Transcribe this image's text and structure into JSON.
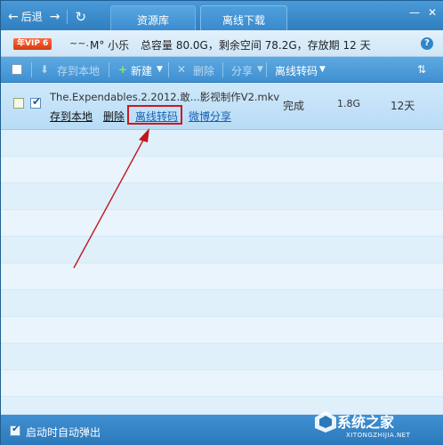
{
  "nav": {
    "back_label": "后退",
    "forward_icon": "forward-arrow-icon",
    "refresh_icon": "refresh-icon"
  },
  "tabs": [
    {
      "label": "资源库"
    },
    {
      "label": "离线下载"
    }
  ],
  "window": {
    "minimize_icon": "minimize-icon",
    "close_icon": "close-icon"
  },
  "account": {
    "vip_badge": "年VIP 6",
    "wave": "~~.",
    "username": "M° 小乐",
    "quota_text": "总容量 80.0G，剩余空间 78.2G，存放期 12 天",
    "help": "?"
  },
  "toolbar": {
    "save_local": "存到本地",
    "new": "新建",
    "delete": "删除",
    "share": "分享",
    "transcode": "离线转码",
    "sort_icon": "sort-icon"
  },
  "tasks": [
    {
      "name": "The.Expendables.2.2012.敢...影视制作V2.mkv",
      "actions": [
        "存到本地",
        "删除",
        "离线转码",
        "微博分享"
      ],
      "status": "完成",
      "size": "1.8G",
      "days": "12天"
    }
  ],
  "footer": {
    "autopopup_label": "启动时自动弹出"
  },
  "watermark": {
    "text": "系统之家",
    "sub": "XITONGZHIJIA.NET"
  },
  "colors": {
    "accent": "#3d8fd0",
    "highlight": "#d1161b",
    "list_bg": "#e9f4fc"
  }
}
